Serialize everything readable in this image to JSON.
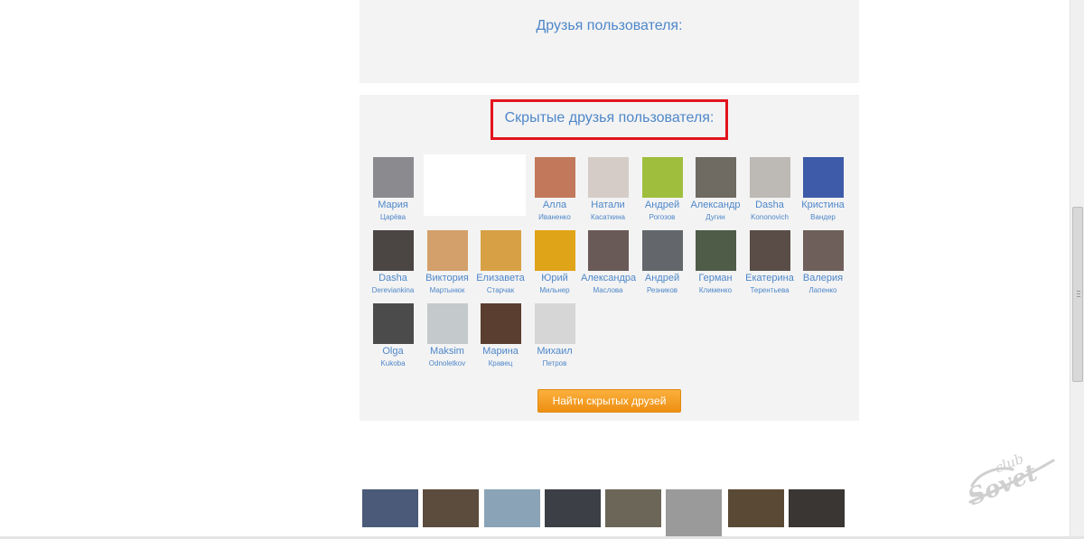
{
  "friends_section": {
    "title": "Друзья пользователя:"
  },
  "hidden_section": {
    "title": "Скрытые друзья пользователя:",
    "find_button": "Найти скрытых друзей",
    "friends": [
      {
        "first": "Мария",
        "last": "Царёва",
        "color": "#8b8a8f"
      },
      {
        "first": "",
        "last": "",
        "color": "#b79a88"
      },
      {
        "first": "",
        "last": "",
        "color": "#a08c7a"
      },
      {
        "first": "Алла",
        "last": "Иваненко",
        "color": "#c2785a"
      },
      {
        "first": "Натали",
        "last": "Касаткина",
        "color": "#d5ccc7"
      },
      {
        "first": "Андрей",
        "last": "Рогозов",
        "color": "#9fbe3d"
      },
      {
        "first": "Александр",
        "last": "Дугин",
        "color": "#6f6a62"
      },
      {
        "first": "Dasha",
        "last": "Kononovich",
        "color": "#bdbab6"
      },
      {
        "first": "Кристина",
        "last": "Вандер",
        "color": "#3d5ba8"
      },
      {
        "first": "Dasha",
        "last": "Dereviankina",
        "color": "#4b4544"
      },
      {
        "first": "Виктория",
        "last": "Мартынюк",
        "color": "#d3a06b"
      },
      {
        "first": "Елизавета",
        "last": "Старчак",
        "color": "#d8a045"
      },
      {
        "first": "Юрий",
        "last": "Мильнер",
        "color": "#e0a418"
      },
      {
        "first": "Александра",
        "last": "Маслова",
        "color": "#6a5a57"
      },
      {
        "first": "Андрей",
        "last": "Резников",
        "color": "#63676b"
      },
      {
        "first": "Герман",
        "last": "Клименко",
        "color": "#4f5c48"
      },
      {
        "first": "Екатерина",
        "last": "Терентьева",
        "color": "#5a4c46"
      },
      {
        "first": "Валерия",
        "last": "Лапенко",
        "color": "#6e5f5b"
      },
      {
        "first": "Olga",
        "last": "Kukoba",
        "color": "#4b4b4b"
      },
      {
        "first": "Maksim",
        "last": "Odnoletkov",
        "color": "#c4c9cc"
      },
      {
        "first": "Марина",
        "last": "Кравец",
        "color": "#5a3e30"
      },
      {
        "first": "Михаил",
        "last": "Петров",
        "color": "#d6d6d6"
      }
    ]
  },
  "photo_strip": [
    {
      "color": "#4a5a78"
    },
    {
      "color": "#5b4c3e"
    },
    {
      "color": "#8aa3b6"
    },
    {
      "color": "#3c3f45"
    },
    {
      "color": "#6b6657"
    },
    {
      "color": "#9a9a9a"
    },
    {
      "color": "#5a4a35"
    },
    {
      "color": "#3a3634"
    }
  ],
  "watermark": {
    "line1": "club",
    "line2": "Sovet"
  }
}
